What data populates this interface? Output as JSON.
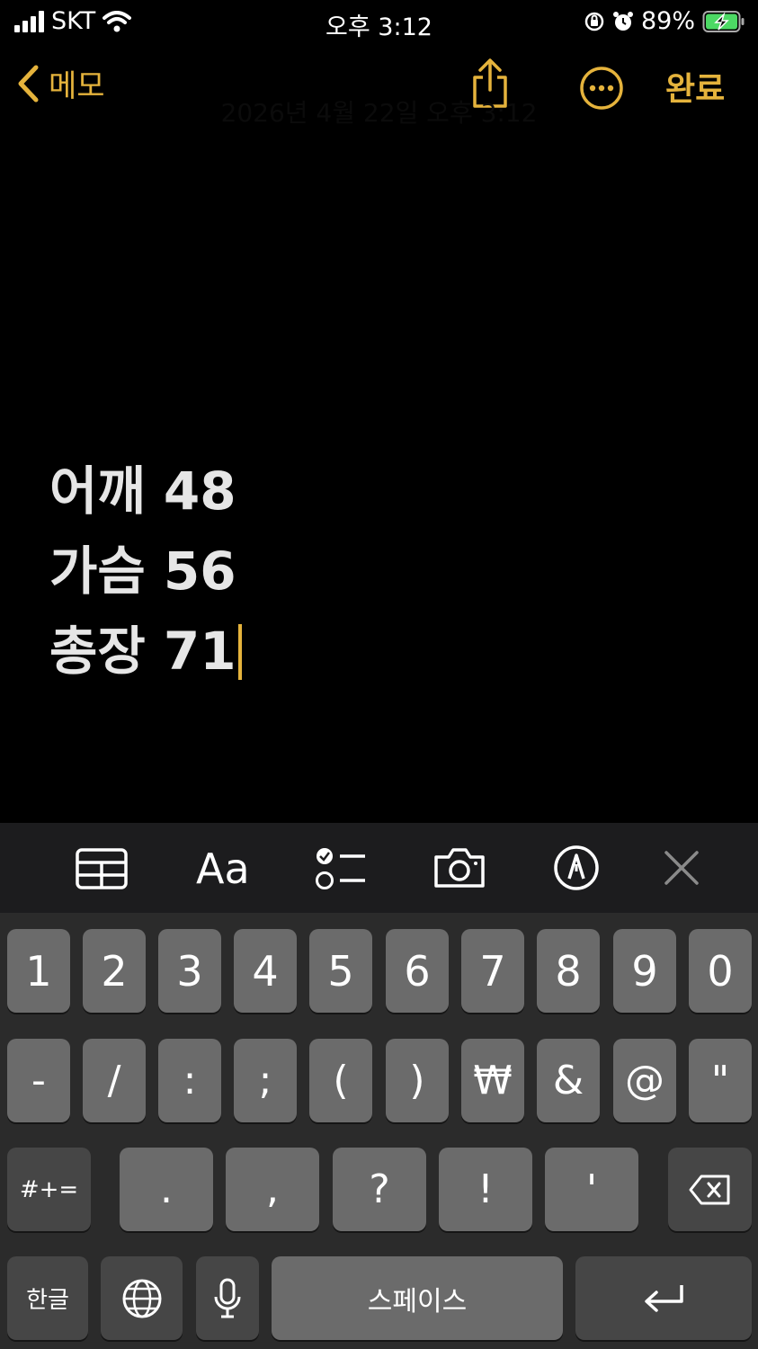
{
  "status_bar": {
    "carrier": "SKT",
    "time": "오후 3:12",
    "battery": "89%"
  },
  "nav": {
    "back_label": "메모",
    "done_label": "완료",
    "date_text": "2026년 4월 22일 오후 3:12"
  },
  "note": {
    "lines": [
      "어깨 48",
      "가슴 56",
      "총장 71"
    ]
  },
  "keyboard": {
    "row1": [
      "1",
      "2",
      "3",
      "4",
      "5",
      "6",
      "7",
      "8",
      "9",
      "0"
    ],
    "row2": [
      "-",
      "/",
      ":",
      ";",
      "(",
      ")",
      "₩",
      "&",
      "@",
      "\""
    ],
    "row3_left": "#+=",
    "row3": [
      ".",
      ",",
      "?",
      "!",
      "'"
    ],
    "lang": "한글",
    "space": "스페이스"
  },
  "toolbar": {
    "format_label": "Aa"
  },
  "colors": {
    "accent": "#e5b33c",
    "background": "#000000",
    "key": "#6b6b6b",
    "key_dark": "#464646"
  }
}
